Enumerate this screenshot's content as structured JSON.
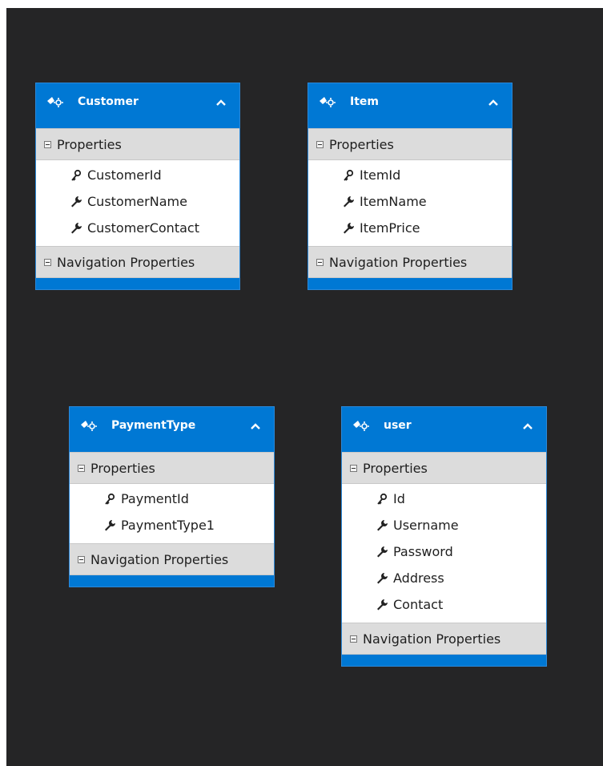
{
  "entities": [
    {
      "title": "Customer",
      "sections": {
        "properties": "Properties",
        "navigation": "Navigation Properties"
      },
      "properties": [
        {
          "name": "CustomerId",
          "icon": "key-icon"
        },
        {
          "name": "CustomerName",
          "icon": "wrench-icon"
        },
        {
          "name": "CustomerContact",
          "icon": "wrench-icon"
        }
      ]
    },
    {
      "title": "Item",
      "sections": {
        "properties": "Properties",
        "navigation": "Navigation Properties"
      },
      "properties": [
        {
          "name": "ItemId",
          "icon": "key-icon"
        },
        {
          "name": "ItemName",
          "icon": "wrench-icon"
        },
        {
          "name": "ItemPrice",
          "icon": "wrench-icon"
        }
      ]
    },
    {
      "title": "PaymentType",
      "sections": {
        "properties": "Properties",
        "navigation": "Navigation Properties"
      },
      "properties": [
        {
          "name": "PaymentId",
          "icon": "key-icon"
        },
        {
          "name": "PaymentType1",
          "icon": "wrench-icon"
        }
      ]
    },
    {
      "title": "user",
      "sections": {
        "properties": "Properties",
        "navigation": "Navigation Properties"
      },
      "properties": [
        {
          "name": "Id",
          "icon": "key-icon"
        },
        {
          "name": "Username",
          "icon": "wrench-icon"
        },
        {
          "name": "Password",
          "icon": "wrench-icon"
        },
        {
          "name": "Address",
          "icon": "wrench-icon"
        },
        {
          "name": "Contact",
          "icon": "wrench-icon"
        }
      ]
    }
  ],
  "colors": {
    "canvas": "#252526",
    "header": "#0078d4",
    "section": "#dcdcdc",
    "body": "#ffffff"
  }
}
